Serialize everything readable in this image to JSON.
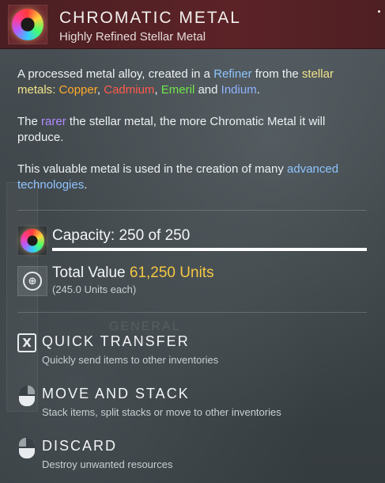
{
  "header": {
    "title": "CHROMATIC METAL",
    "subtitle": "Highly Refined Stellar Metal",
    "icon": "chromatic-metal-orb-icon"
  },
  "description": {
    "p1": {
      "t1": "A processed metal alloy, created in a ",
      "refiner": "Refiner",
      "t2": " from the ",
      "stellar_metals": "stellar metals",
      "t3": ": ",
      "copper": "Copper",
      "c1": ", ",
      "cadmium": "Cadmium",
      "c2": ", ",
      "emeril": "Emeril",
      "t4": " and ",
      "indium": "Indium",
      "t5": "."
    },
    "p2": {
      "t1": "The ",
      "rarer": "rarer",
      "t2": " the stellar metal, the more Chromatic Metal it will produce."
    },
    "p3": {
      "t1": "This valuable metal is used in the creation of many ",
      "advanced": "advanced technologies",
      "t2": "."
    }
  },
  "capacity": {
    "label": "Capacity: 250 of 250",
    "current": 250,
    "max": 250,
    "fill_fraction": 1.0
  },
  "value": {
    "label": "Total Value",
    "amount": "61,250 Units",
    "each": "(245.0 Units each)",
    "icon": "units-currency-icon"
  },
  "actions": [
    {
      "title": "QUICK TRANSFER",
      "desc": "Quickly send items to other inventories",
      "icon": "x-key-icon"
    },
    {
      "title": "MOVE AND STACK",
      "desc": "Stack items, split stacks or move to other inventories",
      "icon": "mouse-left-click-icon"
    },
    {
      "title": "DISCARD",
      "desc": "Destroy unwanted resources",
      "icon": "mouse-right-click-icon"
    }
  ],
  "background": {
    "label": "GENERAL"
  },
  "colors": {
    "header_bg": "#5c2327",
    "highlight_blue": "#8fc4ff",
    "highlight_yellow": "#f2e48a",
    "copper": "#ffaa2a",
    "cadmium": "#ff5a4a",
    "emeril": "#6fe84a",
    "indium": "#8fb2ff",
    "rarer": "#b18cff",
    "value_amount": "#f5c842"
  }
}
